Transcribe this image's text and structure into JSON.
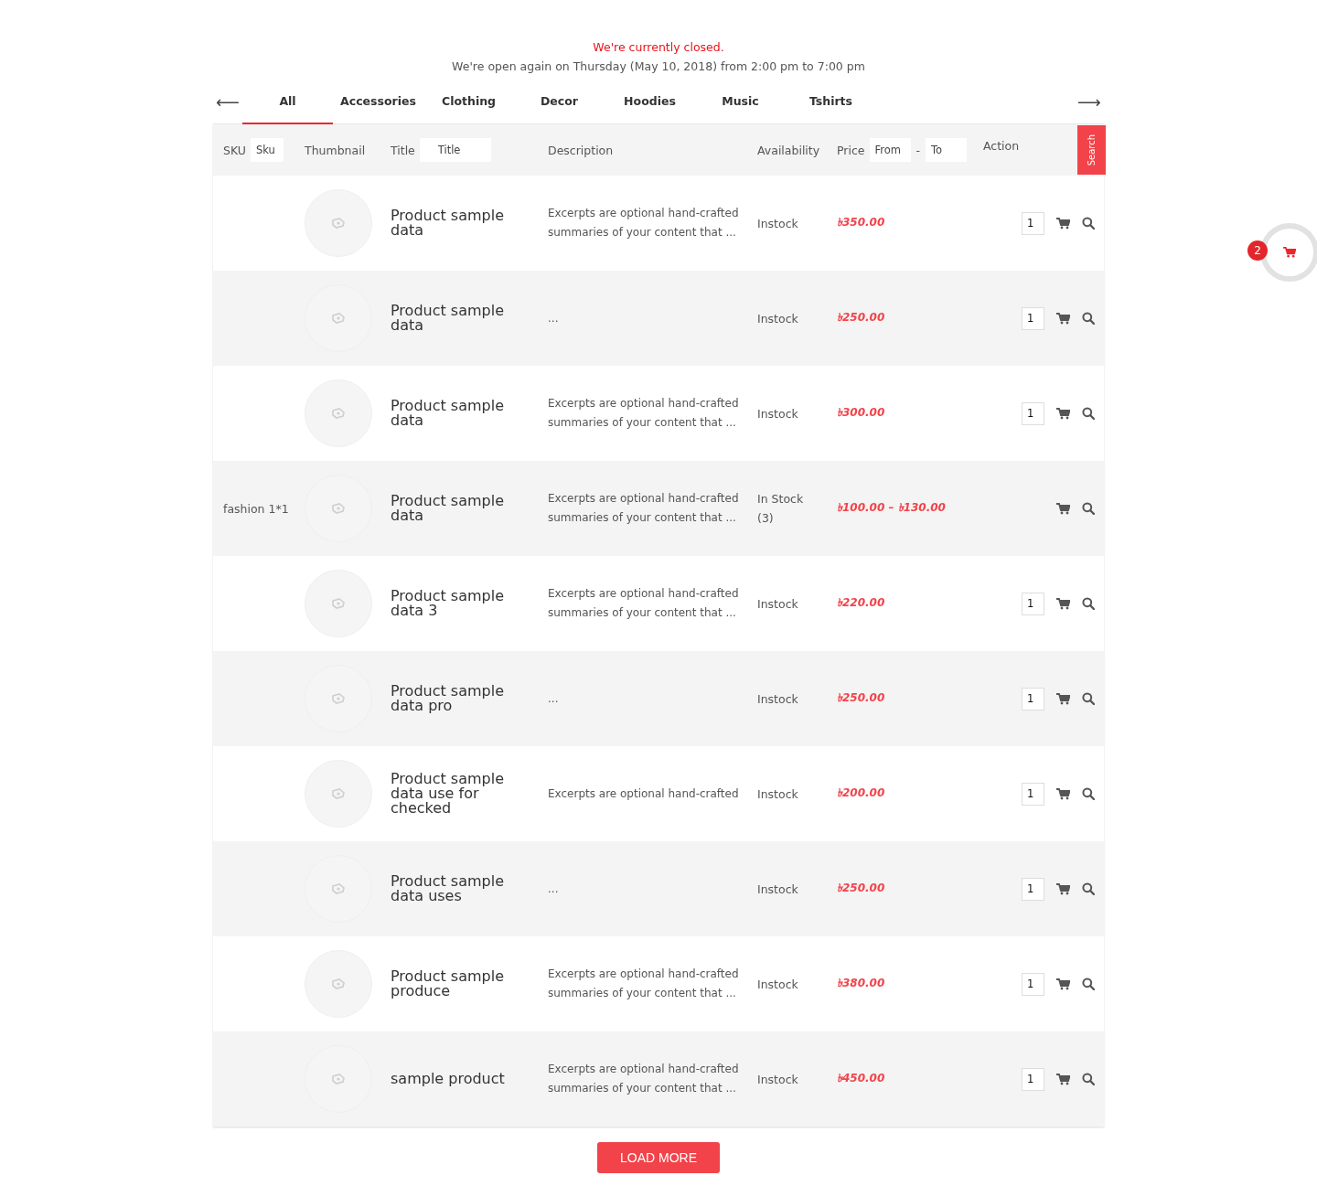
{
  "notice": {
    "closed": "We're currently closed.",
    "reopen": "We're open again on Thursday (May 10, 2018) from 2:00 pm to 7:00 pm"
  },
  "tabs": [
    {
      "label": "All",
      "selected": true
    },
    {
      "label": "Accessories",
      "selected": false
    },
    {
      "label": "Clothing",
      "selected": false
    },
    {
      "label": "Decor",
      "selected": false
    },
    {
      "label": "Hoodies",
      "selected": false
    },
    {
      "label": "Music",
      "selected": false
    },
    {
      "label": "Tshirts",
      "selected": false
    }
  ],
  "nav": {
    "prev": "⟵",
    "next": "⟶"
  },
  "filters": {
    "sku_label": "SKU",
    "sku_placeholder": "Sku",
    "thumbnail": "Thumbnail",
    "title_label": "Title",
    "title_placeholder": "Title",
    "description": "Description",
    "availability": "Availability",
    "price_label": "Price",
    "price_from_placeholder": "From",
    "separator": "-",
    "price_to_placeholder": "To",
    "action": "Action",
    "search_button": "Search"
  },
  "rows": [
    {
      "title": "Product sample data",
      "description": "Excerpts are optional hand-crafted summaries of your content that ...",
      "availability": "Instock",
      "price": "৳350.00",
      "qty": "1"
    },
    {
      "title": "Product sample data",
      "description": "...",
      "availability": "Instock",
      "price": "৳250.00",
      "qty": "1"
    },
    {
      "title": "Product sample data",
      "description": "Excerpts are optional hand-crafted summaries of your content that ...",
      "availability": "Instock",
      "price": "৳300.00",
      "qty": "1"
    },
    {
      "sku": "fashion 1*1",
      "title": "Product sample data",
      "description": "Excerpts are optional hand-crafted summaries of your content that ...",
      "availability": "In Stock (3)",
      "price": "৳100.00 – ৳130.00"
    },
    {
      "title": "Product sample data 3",
      "description": "Excerpts are optional hand-crafted summaries of your content that ...",
      "availability": "Instock",
      "price": "৳220.00",
      "qty": "1"
    },
    {
      "title": "Product sample data pro",
      "description": "...",
      "availability": "Instock",
      "price": "৳250.00",
      "qty": "1"
    },
    {
      "title": "Product sample data use for checked",
      "description": "Excerpts are optional hand-crafted",
      "availability": "Instock",
      "price": "৳200.00",
      "qty": "1"
    },
    {
      "title": "Product sample data uses",
      "description": "...",
      "availability": "Instock",
      "price": "৳250.00",
      "qty": "1"
    },
    {
      "title": "Product sample produce",
      "description": "Excerpts are optional hand-crafted summaries of your content that ...",
      "availability": "Instock",
      "price": "৳380.00",
      "qty": "1"
    },
    {
      "title": "sample product",
      "description": "Excerpts are optional hand-crafted summaries of your content that ...",
      "availability": "Instock",
      "price": "৳450.00",
      "qty": "1"
    }
  ],
  "load_more": "LOAD MORE",
  "cart": {
    "count": "2"
  }
}
